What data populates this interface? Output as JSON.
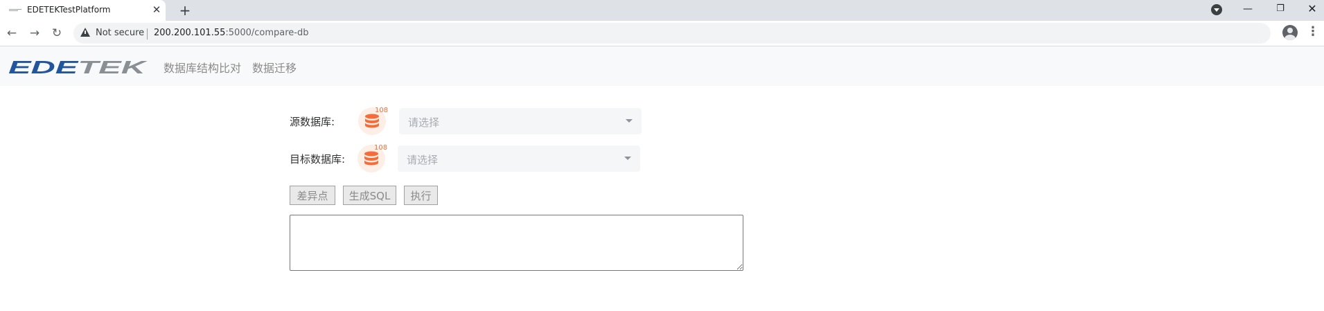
{
  "browser": {
    "tab_title": "EDETEKTestPlatform",
    "security_label": "Not secure",
    "url_host": "200.200.101.55",
    "url_rest": ":5000/compare-db"
  },
  "app": {
    "logo_text": "EDETEK",
    "brand_color": "#23559c",
    "logo_gray": "#8a8f96",
    "nav": [
      {
        "label": "数据库结构比对"
      },
      {
        "label": "数据迁移"
      }
    ]
  },
  "form": {
    "source": {
      "label": "源数据库:",
      "badge": "108",
      "placeholder": "请选择"
    },
    "target": {
      "label": "目标数据库:",
      "badge": "108",
      "placeholder": "请选择"
    },
    "buttons": {
      "diff": "差异点",
      "gen_sql": "生成SQL",
      "execute": "执行"
    },
    "result_text": ""
  },
  "icons": {
    "db_icon": "database-icon",
    "db_icon_color": "#f56c38"
  }
}
